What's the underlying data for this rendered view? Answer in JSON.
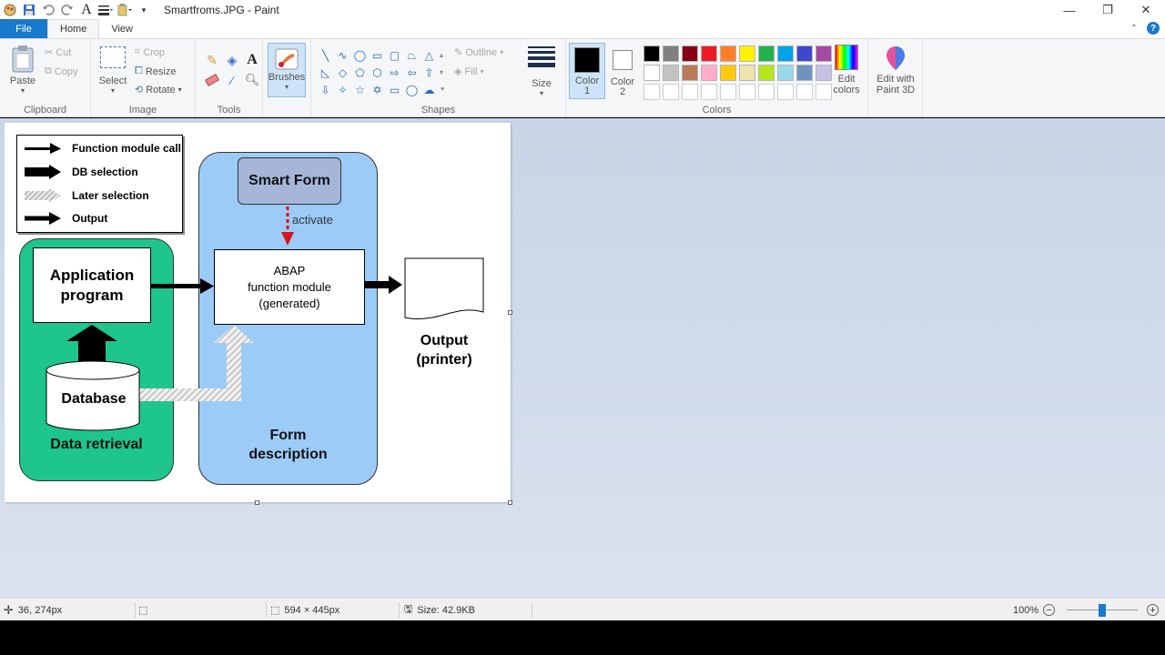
{
  "window": {
    "title": "Smartfroms.JPG - Paint"
  },
  "tabs": {
    "file": "File",
    "home": "Home",
    "view": "View"
  },
  "clipboard": {
    "paste": "Paste",
    "cut": "Cut",
    "copy": "Copy",
    "label": "Clipboard"
  },
  "image": {
    "select": "Select",
    "crop": "Crop",
    "resize": "Resize",
    "rotate": "Rotate",
    "label": "Image"
  },
  "tools": {
    "label": "Tools"
  },
  "brushes": {
    "label": "Brushes"
  },
  "shapes": {
    "outline": "Outline",
    "fill": "Fill",
    "label": "Shapes"
  },
  "size": {
    "label": "Size"
  },
  "colors": {
    "color1": "Color",
    "color1_num": "1",
    "color2": "Color",
    "color2_num": "2",
    "edit_colors_1": "Edit",
    "edit_colors_2": "colors",
    "label": "Colors",
    "palette_row1": [
      "#000000",
      "#7f7f7f",
      "#880015",
      "#ed1c24",
      "#ff7f27",
      "#fff200",
      "#22b14c",
      "#00a2e8",
      "#3f48cc",
      "#a349a4"
    ],
    "palette_row2": [
      "#ffffff",
      "#c3c3c3",
      "#b97a57",
      "#ffaec9",
      "#ffc90e",
      "#efe4b0",
      "#b5e61d",
      "#99d9ea",
      "#7092be",
      "#c8bfe7"
    ]
  },
  "paint3d": {
    "line1": "Edit with",
    "line2": "Paint 3D"
  },
  "diagram": {
    "legend": {
      "function_call": "Function module call",
      "db_selection": "DB selection",
      "later_selection": "Later selection",
      "output": "Output"
    },
    "smart_form": "Smart Form",
    "activate": "activate",
    "app_line1": "Application",
    "app_line2": "program",
    "abap_line1": "ABAP",
    "abap_line2": "function module",
    "abap_line3": "(generated)",
    "database": "Database",
    "data_retrieval": "Data retrieval",
    "form_line1": "Form",
    "form_line2": "description",
    "output_line1": "Output",
    "output_line2": "(printer)"
  },
  "status": {
    "cursor": "36, 274px",
    "dimensions": "594 × 445px",
    "size": "Size: 42.9KB",
    "zoom": "100%"
  }
}
